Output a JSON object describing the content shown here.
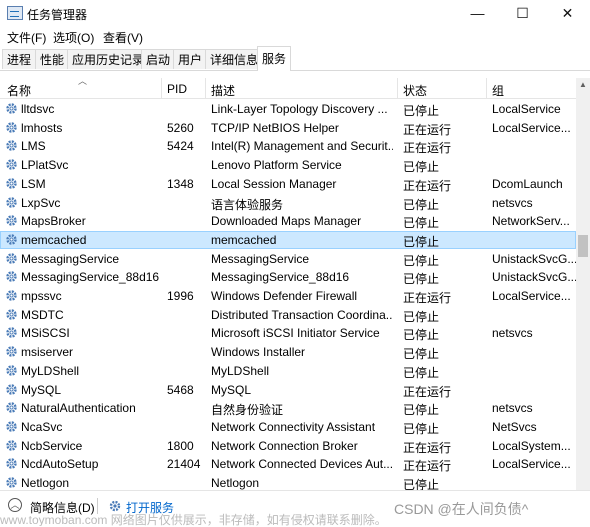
{
  "window": {
    "title": "任务管理器",
    "minimize": "—",
    "maximize": "☐",
    "close": "✕"
  },
  "menu": [
    "文件(F)",
    "选项(O)",
    "查看(V)"
  ],
  "tabs": [
    "进程",
    "性能",
    "应用历史记录",
    "启动",
    "用户",
    "详细信息",
    "服务"
  ],
  "active_tab": "服务",
  "columns": {
    "name": "名称",
    "pid": "PID",
    "desc": "描述",
    "status": "状态",
    "group": "组"
  },
  "services": [
    {
      "name": "lltdsvc",
      "pid": "",
      "desc": "Link-Layer Topology Discovery ...",
      "status": "已停止",
      "group": "LocalService"
    },
    {
      "name": "lmhosts",
      "pid": "5260",
      "desc": "TCP/IP NetBIOS Helper",
      "status": "正在运行",
      "group": "LocalService..."
    },
    {
      "name": "LMS",
      "pid": "5424",
      "desc": "Intel(R) Management and Securit...",
      "status": "正在运行",
      "group": ""
    },
    {
      "name": "LPlatSvc",
      "pid": "",
      "desc": "Lenovo Platform Service",
      "status": "已停止",
      "group": ""
    },
    {
      "name": "LSM",
      "pid": "1348",
      "desc": "Local Session Manager",
      "status": "正在运行",
      "group": "DcomLaunch"
    },
    {
      "name": "LxpSvc",
      "pid": "",
      "desc": "语言体验服务",
      "status": "已停止",
      "group": "netsvcs"
    },
    {
      "name": "MapsBroker",
      "pid": "",
      "desc": "Downloaded Maps Manager",
      "status": "已停止",
      "group": "NetworkServ..."
    },
    {
      "name": "memcached",
      "pid": "",
      "desc": "memcached",
      "status": "已停止",
      "group": ""
    },
    {
      "name": "MessagingService",
      "pid": "",
      "desc": "MessagingService",
      "status": "已停止",
      "group": "UnistackSvcG..."
    },
    {
      "name": "MessagingService_88d16",
      "pid": "",
      "desc": "MessagingService_88d16",
      "status": "已停止",
      "group": "UnistackSvcG..."
    },
    {
      "name": "mpssvc",
      "pid": "1996",
      "desc": "Windows Defender Firewall",
      "status": "正在运行",
      "group": "LocalService..."
    },
    {
      "name": "MSDTC",
      "pid": "",
      "desc": "Distributed Transaction Coordina...",
      "status": "已停止",
      "group": ""
    },
    {
      "name": "MSiSCSI",
      "pid": "",
      "desc": "Microsoft iSCSI Initiator Service",
      "status": "已停止",
      "group": "netsvcs"
    },
    {
      "name": "msiserver",
      "pid": "",
      "desc": "Windows Installer",
      "status": "已停止",
      "group": ""
    },
    {
      "name": "MyLDShell",
      "pid": "",
      "desc": "MyLDShell",
      "status": "已停止",
      "group": ""
    },
    {
      "name": "MySQL",
      "pid": "5468",
      "desc": "MySQL",
      "status": "正在运行",
      "group": ""
    },
    {
      "name": "NaturalAuthentication",
      "pid": "",
      "desc": "自然身份验证",
      "status": "已停止",
      "group": "netsvcs"
    },
    {
      "name": "NcaSvc",
      "pid": "",
      "desc": "Network Connectivity Assistant",
      "status": "已停止",
      "group": "NetSvcs"
    },
    {
      "name": "NcbService",
      "pid": "1800",
      "desc": "Network Connection Broker",
      "status": "正在运行",
      "group": "LocalSystem..."
    },
    {
      "name": "NcdAutoSetup",
      "pid": "21404",
      "desc": "Network Connected Devices Aut...",
      "status": "正在运行",
      "group": "LocalService..."
    },
    {
      "name": "Netlogon",
      "pid": "",
      "desc": "Netlogon",
      "status": "已停止",
      "group": ""
    }
  ],
  "selected_service": "memcached",
  "footer": {
    "less_label": "简略信息(D)",
    "open_services_label": "打开服务"
  },
  "watermarks": {
    "csdn": "CSDN @在人间负债^",
    "toymoban": "www.toymoban.com 网络图片仅供展示，非存储，如有侵权请联系删除。"
  },
  "icons": {
    "service": "gear-icon",
    "less": "chevron-up-icon",
    "open_services": "services-icon"
  },
  "colors": {
    "selected_bg": "#cce8ff",
    "selected_border": "#99d1ff",
    "link": "#0066cc",
    "gear": "#4a7bb7"
  }
}
